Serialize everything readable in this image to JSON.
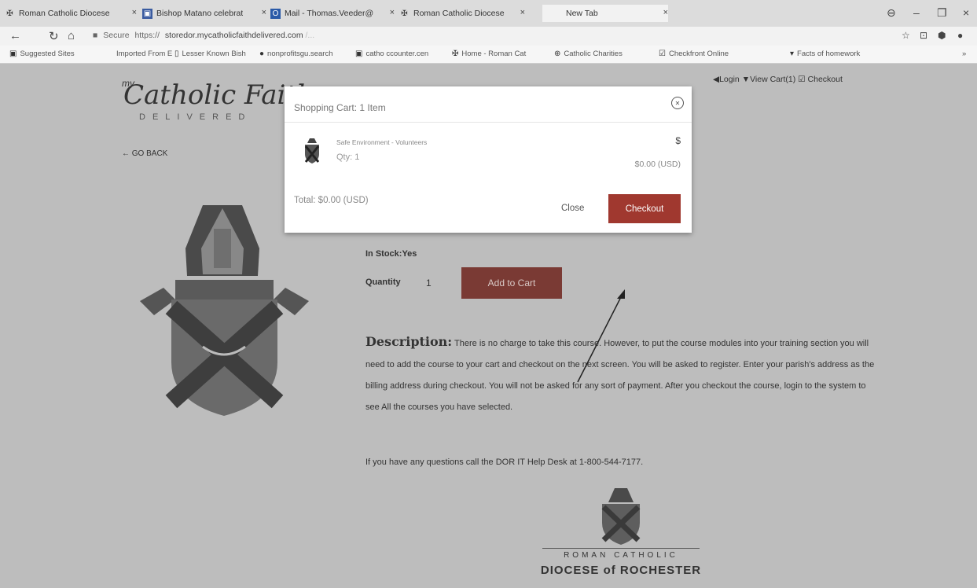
{
  "browser": {
    "tabs": [
      {
        "title": "Roman Catholic Diocese",
        "icon": "diocese-favicon"
      },
      {
        "title": "Bishop Matano celebrat",
        "icon": "news-favicon"
      },
      {
        "title": "Mail - Thomas.Veeder@",
        "icon": "outlook-favicon"
      },
      {
        "title": "Roman Catholic Diocese",
        "icon": "diocese-favicon"
      },
      {
        "title": "New Tab",
        "icon": ""
      }
    ],
    "tab_close": "×",
    "window_controls": {
      "profile": "⊖",
      "minimize": "–",
      "restore": "❐",
      "close": "×"
    },
    "address": {
      "secure_label": "Secure",
      "scheme": "https://",
      "host": "storedor.mycatholicfaithdelivered.com",
      "path": "/..."
    },
    "bookmarks": [
      "Suggested Sites",
      "Imported From E",
      "Lesser Known Bish",
      "nonprofitsgu.search",
      "catho ccounter.cen",
      "Home - Roman Cat",
      "Catholic Charities",
      "Checkfront Online",
      "Facts of homework"
    ]
  },
  "site": {
    "logo_my": "my",
    "logo_main": "Catholic Faith",
    "logo_sub": "DELIVERED",
    "go_back": "← GO BACK",
    "top_links": {
      "login": "◀Login",
      "view_cart": "▼View Cart(1)",
      "checkout": "☑ Checkout"
    }
  },
  "product": {
    "in_stock_label": "In Stock:Yes",
    "quantity_label": "Quantity",
    "quantity_value": "1",
    "add_to_cart": "Add to Cart",
    "description_heading": "Description:",
    "description_text": "There is no charge to take this course. However, to put the course modules into your training section you will need to add the course to your cart and checkout on the next screen. You will be asked to register. Enter your parish's address as the billing address during checkout. You will not be asked for any sort of payment. After you checkout the course, login to the system to see All the courses you have selected.",
    "questions_text": "If you have any questions call the DOR IT Help Desk at 1-800-544-7177."
  },
  "footer_logo": {
    "line1": "ROMAN CATHOLIC",
    "line2": "DIOCESE of ROCHESTER"
  },
  "cart_modal": {
    "title": "Shopping Cart: 1 Item",
    "item_name": "Safe Environment - Volunteers",
    "item_qty": "Qty: 1",
    "item_price": "$",
    "item_subprice": "$0.00 (USD)",
    "total": "Total: $0.00 (USD)",
    "close_label": "Close",
    "checkout_label": "Checkout"
  }
}
